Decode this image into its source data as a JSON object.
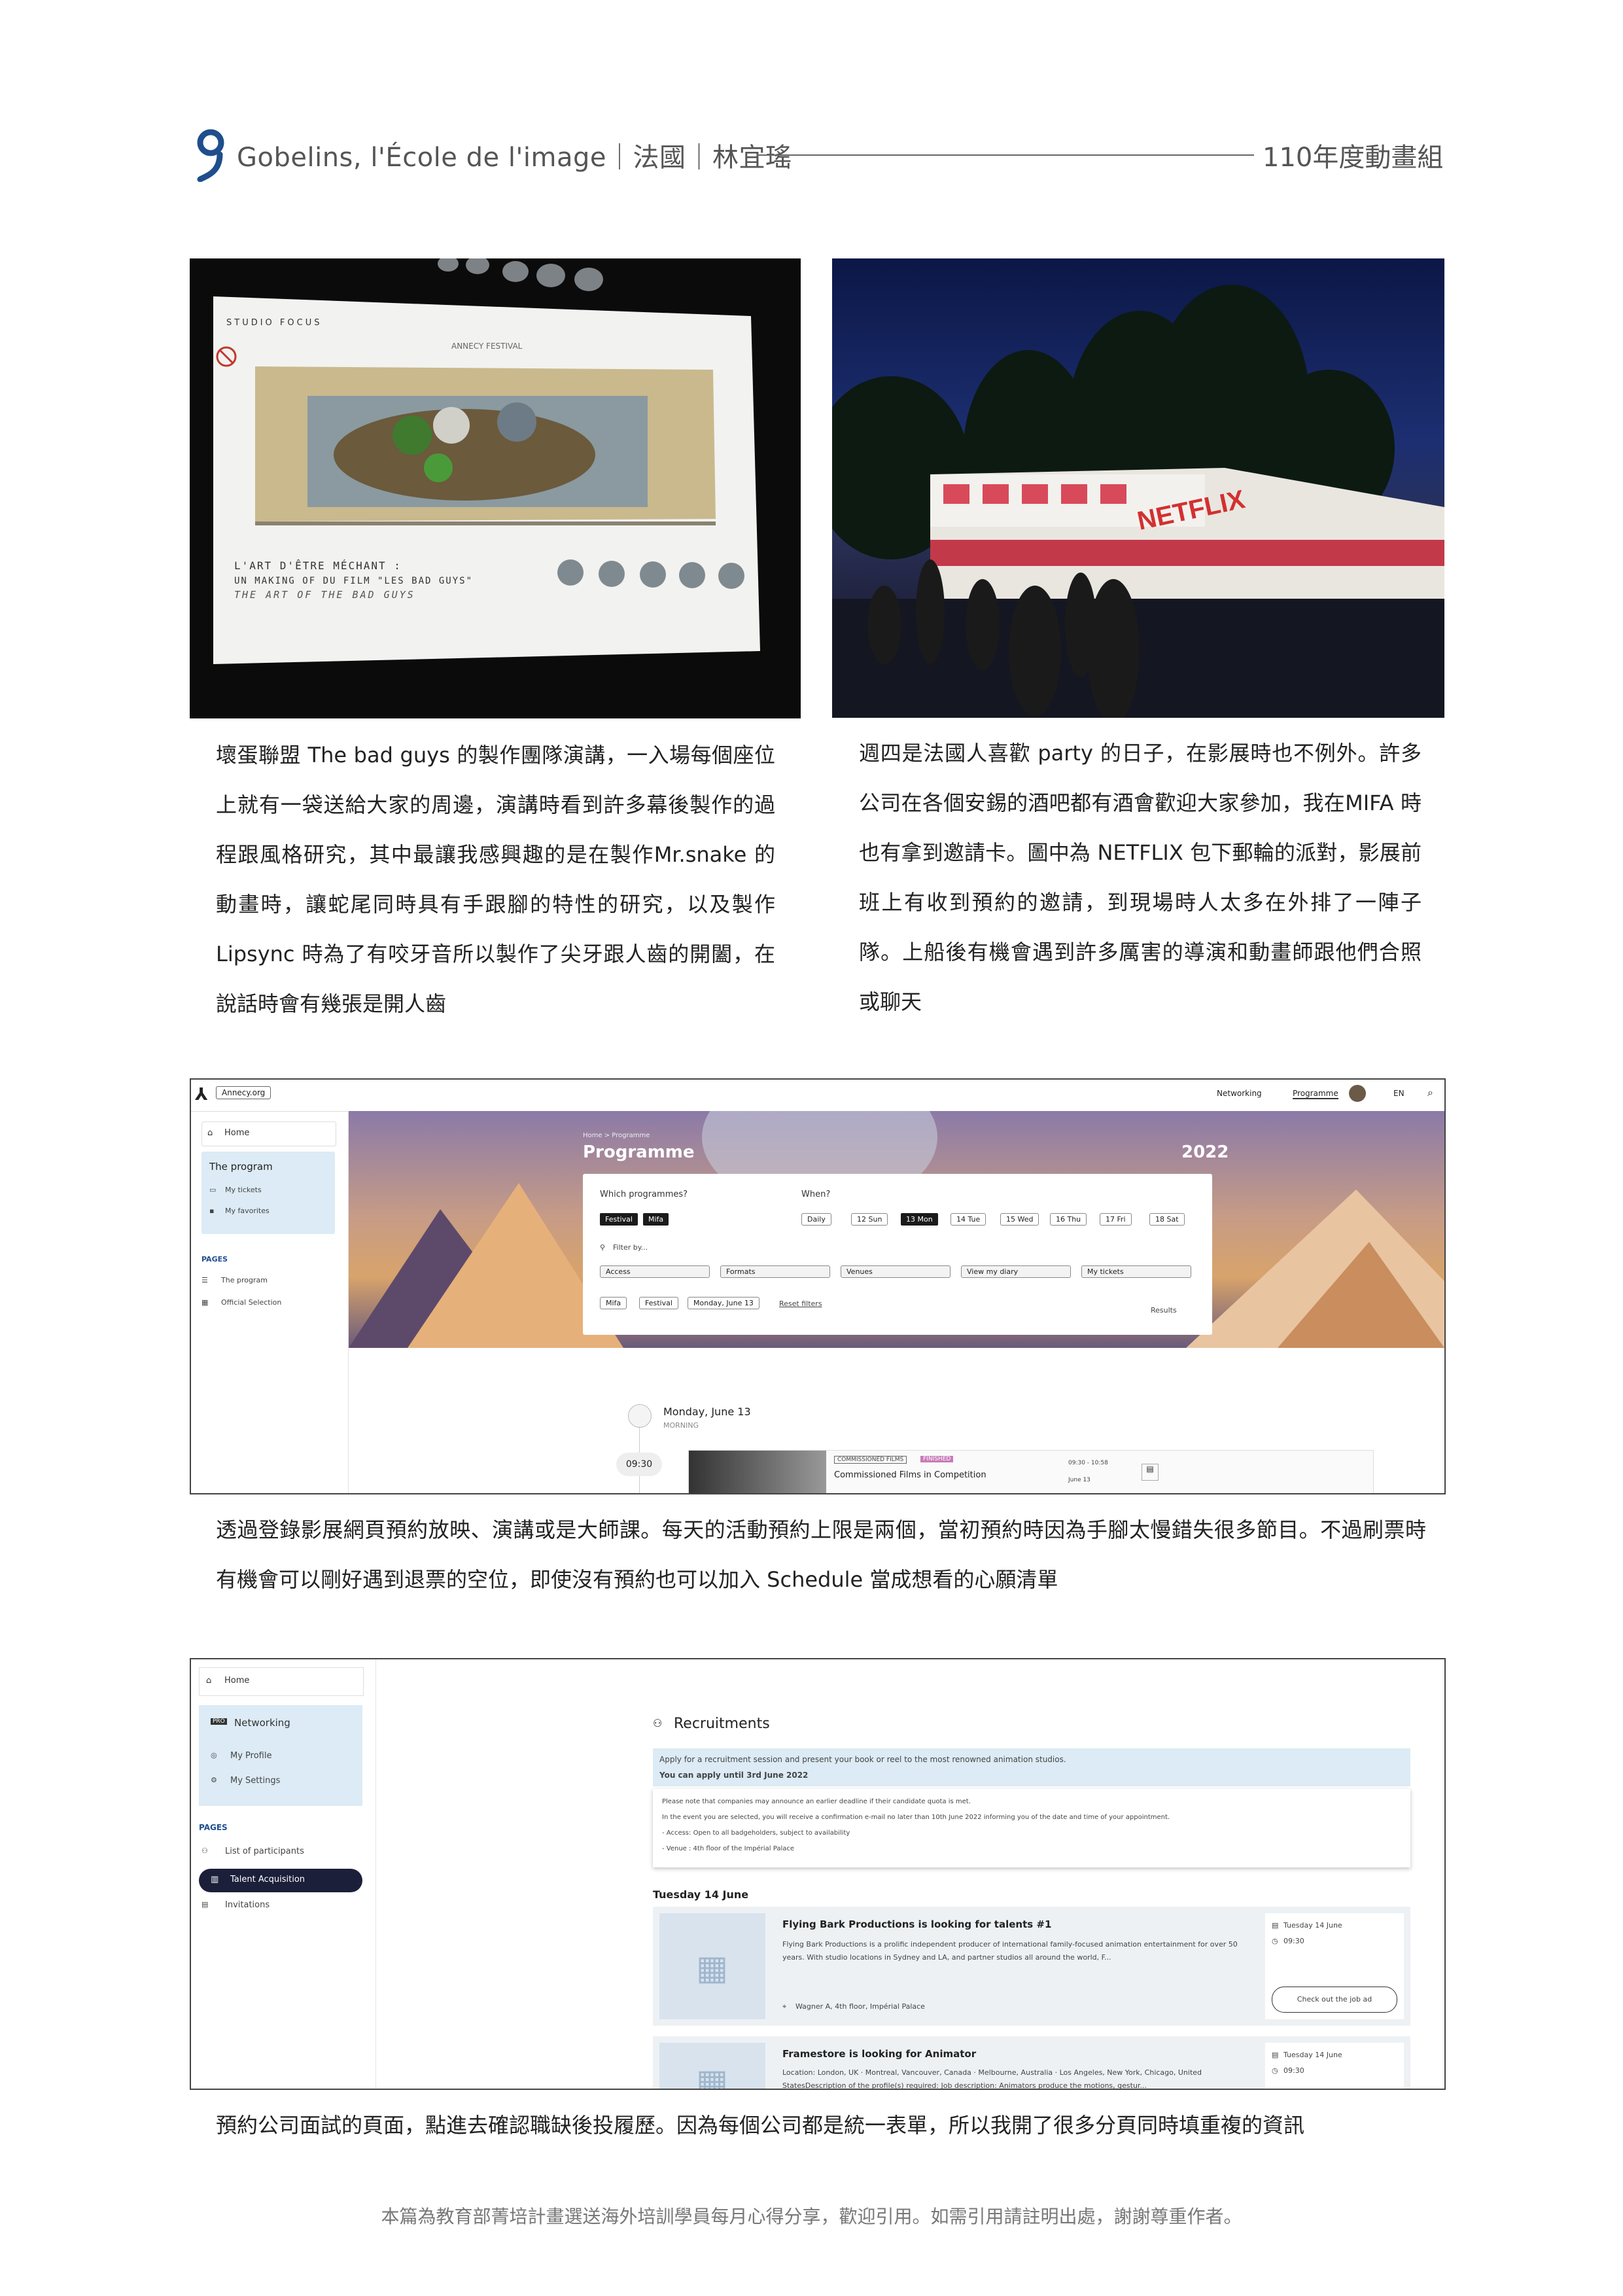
{
  "header": {
    "title": "Gobelins, l'École de l'image｜法國｜林宜瑤",
    "right": "110年度動畫組"
  },
  "photo_left": {
    "studio_focus": "STUDIO FOCUS",
    "talk_title_1": "L'ART D'ÊTRE MÉCHANT :",
    "talk_title_2": "UN MAKING OF DU FILM \"LES BAD GUYS\"",
    "talk_title_3": "THE ART OF THE BAD GUYS",
    "festival": "ANNECY FESTIVAL"
  },
  "photo_right": {
    "sign": "NETFLIX"
  },
  "captions": {
    "left": "壞蛋聯盟 The bad guys 的製作團隊演講，一入場每個座位上就有一袋送給大家的周邊，演講時看到許多幕後製作的過程跟風格研究，其中最讓我感興趣的是在製作Mr.snake 的動畫時，讓蛇尾同時具有手跟腳的特性的研究，以及製作 Lipsync 時為了有咬牙音所以製作了尖牙跟人齒的開闔，在說話時會有幾張是開人齒",
    "right": "週四是法國人喜歡 party 的日子，在影展時也不例外。許多公司在各個安錫的酒吧都有酒會歡迎大家參加，我在MIFA 時也有拿到邀請卡。圖中為 NETFLIX 包下郵輪的派對，影展前班上有收到預約的邀請，到現場時人太多在外排了一陣子隊。上船後有機會遇到許多厲害的導演和動畫師跟他們合照或聊天",
    "mid": "透過登錄影展網頁預約放映、演講或是大師課。每天的活動預約上限是兩個，當初預約時因為手腳太慢錯失很多節目。不過刷票時有機會可以剛好遇到退票的空位，即使沒有預約也可以加入 Schedule 當成想看的心願清單",
    "bottom": "預約公司面試的頁面，點進去確認職缺後投履歷。因為每個公司都是統一表單，所以我開了很多分頁同時填重複的資訊"
  },
  "footer": "本篇為教育部菁培計畫選送海外培訓學員每月心得分享，歡迎引用。如需引用請註明出處，謝謝尊重作者。",
  "programme": {
    "site": "Annecy.org",
    "nav": [
      "Networking",
      "Programme",
      "EN"
    ],
    "sidebar": {
      "home": "Home",
      "program": "The program",
      "my_tickets": "My tickets",
      "my_favorites": "My favorites",
      "pages_heading": "PAGES",
      "page_items": [
        "The program",
        "Official Selection"
      ]
    },
    "breadcrumb": "Home > Programme",
    "heading": "Programme",
    "year": "2022",
    "which_label": "Which programmes?",
    "programme_chips": [
      "Festival",
      "Mifa"
    ],
    "when_label": "When?",
    "days": [
      "Daily",
      "12 Sun",
      "13 Mon",
      "14 Tue",
      "15 Wed",
      "16 Thu",
      "17 Fri",
      "18 Sat"
    ],
    "filter_label": "Filter by...",
    "filters": [
      "Access",
      "Formats",
      "Venues",
      "View my diary",
      "My tickets"
    ],
    "active_tags": [
      "Mifa",
      "Festival",
      "Monday, June 13"
    ],
    "reset": "Reset filters",
    "results": "Results",
    "date_heading": "Monday, June 13",
    "morning": "MORNING",
    "time": "09:30",
    "badge_category": "COMMISSIONED FILMS",
    "badge_status": "FINISHED",
    "event_title": "Commissioned Films in Competition",
    "event_time": "09:30 - 10:58",
    "event_date": "June 13"
  },
  "recruit": {
    "sidebar": {
      "home": "Home",
      "networking": "Networking",
      "my_profile": "My Profile",
      "my_settings": "My Settings",
      "pages_heading": "PAGES",
      "participants": "List of participants",
      "talent": "Talent Acquisition",
      "invitations": "Invitations"
    },
    "heading": "Recruitments",
    "notice_line": "Apply for a recruitment session and present your book or reel to the most renowned animation studios.",
    "notice_bold": "You can apply until 3rd June 2022",
    "note_1": "Please note that companies may announce an earlier deadline if their candidate quota is met.",
    "note_2": "In the event you are selected, you will receive a confirmation e-mail no later than 10th June 2022 informing you of the date and time of your appointment.",
    "note_3": "- Access: Open to all badgeholders, subject to availability",
    "note_4": "- Venue : 4th floor of the Impérial Palace",
    "day_heading": "Tuesday 14 June",
    "cards": [
      {
        "title": "Flying Bark Productions is looking for talents #1",
        "desc": "Flying Bark Productions is a prolific independent producer of international family-focused animation entertainment for over 50 years. With studio locations in Sydney and LA, and partner studios all around the world, F...",
        "location": "Wagner A, 4th floor, Impérial Palace",
        "date": "Tuesday 14 June",
        "time": "09:30",
        "button": "Check out the job ad"
      },
      {
        "title": "Framestore is looking for Animator",
        "desc": "Location: London, UK · Montreal, Vancouver, Canada · Melbourne, Australia · Los Angeles, New York, Chicago, United StatesDescription of the profile(s) required: Job description: Animators produce the motions, gestur...",
        "location": "",
        "date": "Tuesday 14 June",
        "time": "09:30",
        "button": ""
      }
    ]
  }
}
